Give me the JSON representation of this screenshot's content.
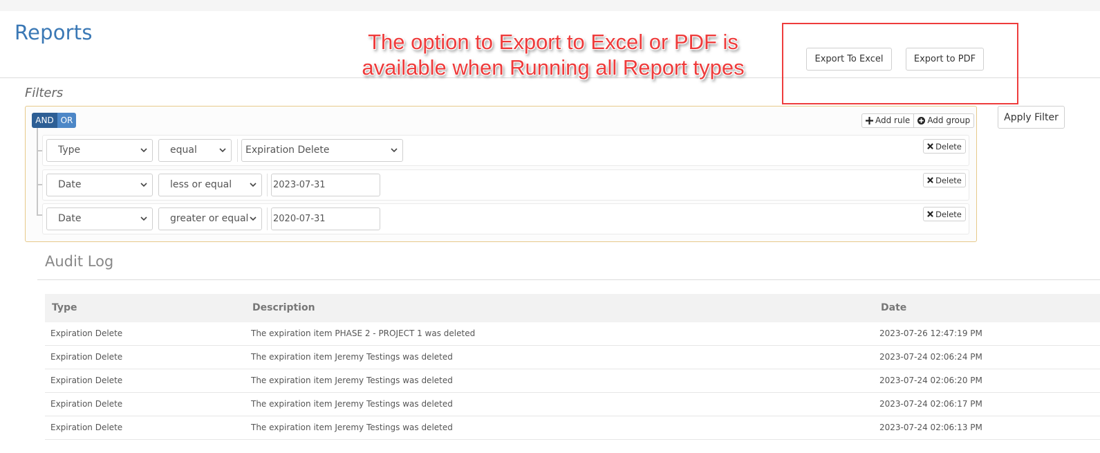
{
  "page": {
    "title": "Reports"
  },
  "annotation": {
    "line1": "The option to Export to Excel or PDF is",
    "line2": "available when Running all Report types",
    "color": "#ee3b3b"
  },
  "toolbar": {
    "export_excel": "Export To Excel",
    "export_pdf": "Export to PDF",
    "apply_filter": "Apply Filter"
  },
  "filters": {
    "label": "Filters",
    "condition": {
      "and_label": "AND",
      "or_label": "OR",
      "selected": "AND"
    },
    "add_rule": "Add rule",
    "add_group": "Add group",
    "delete_label": "Delete",
    "rules": [
      {
        "field": "Type",
        "operator": "equal",
        "value": "Expiration Delete"
      },
      {
        "field": "Date",
        "operator": "less or equal",
        "value": "2023-07-31"
      },
      {
        "field": "Date",
        "operator": "greater or equal",
        "value": "2020-07-31"
      }
    ]
  },
  "audit": {
    "title": "Audit Log",
    "columns": [
      "Type",
      "Description",
      "Date"
    ],
    "rows": [
      [
        "Expiration Delete",
        "The expiration item PHASE 2 - PROJECT 1 was deleted",
        "2023-07-26 12:47:19 PM"
      ],
      [
        "Expiration Delete",
        "The expiration item Jeremy Testings was deleted",
        "2023-07-24 02:06:24 PM"
      ],
      [
        "Expiration Delete",
        "The expiration item Jeremy Testings was deleted",
        "2023-07-24 02:06:20 PM"
      ],
      [
        "Expiration Delete",
        "The expiration item Jeremy Testings was deleted",
        "2023-07-24 02:06:17 PM"
      ],
      [
        "Expiration Delete",
        "The expiration item Jeremy Testings was deleted",
        "2023-07-24 02:06:13 PM"
      ]
    ]
  },
  "colors": {
    "accent": "#3a78b5",
    "and_active": "#2e5f95",
    "or_inactive": "#4d87c7",
    "panel_border": "#e7c98a"
  }
}
